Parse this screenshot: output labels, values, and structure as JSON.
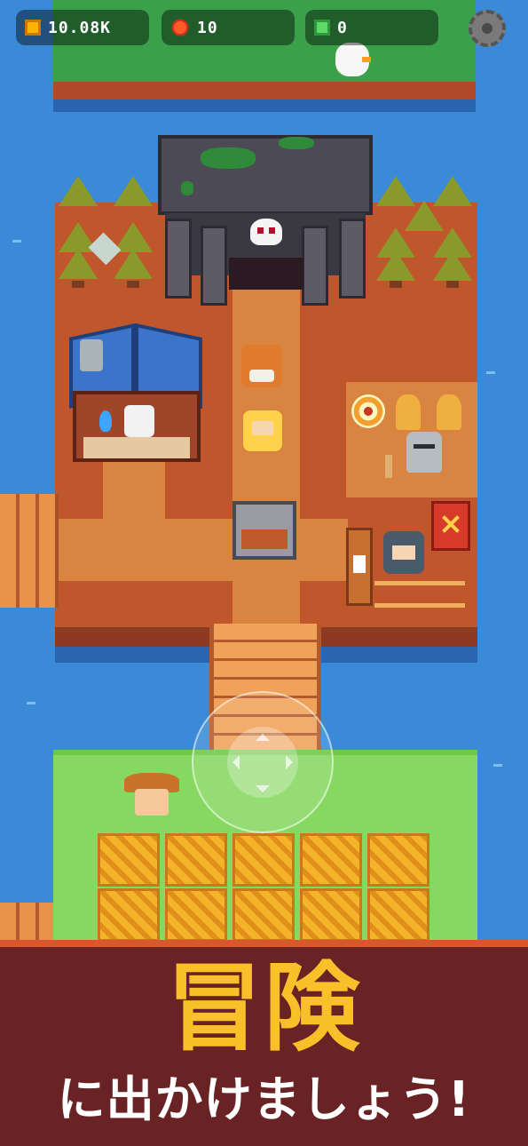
{
  "hud": {
    "coins": "10.08K",
    "hearts": "10",
    "gems": "0",
    "icons": {
      "coin": "coin-icon",
      "heart": "heart-icon",
      "gem": "gem-icon",
      "settings": "gear-icon"
    }
  },
  "promo": {
    "title": "冒険",
    "subtitle": "に出かけましょう!"
  },
  "colors": {
    "water": "#3a8ad8",
    "ground": "#c0562c",
    "grass": "#86d860",
    "banner": "#6a2324",
    "title": "#f9c02a"
  }
}
